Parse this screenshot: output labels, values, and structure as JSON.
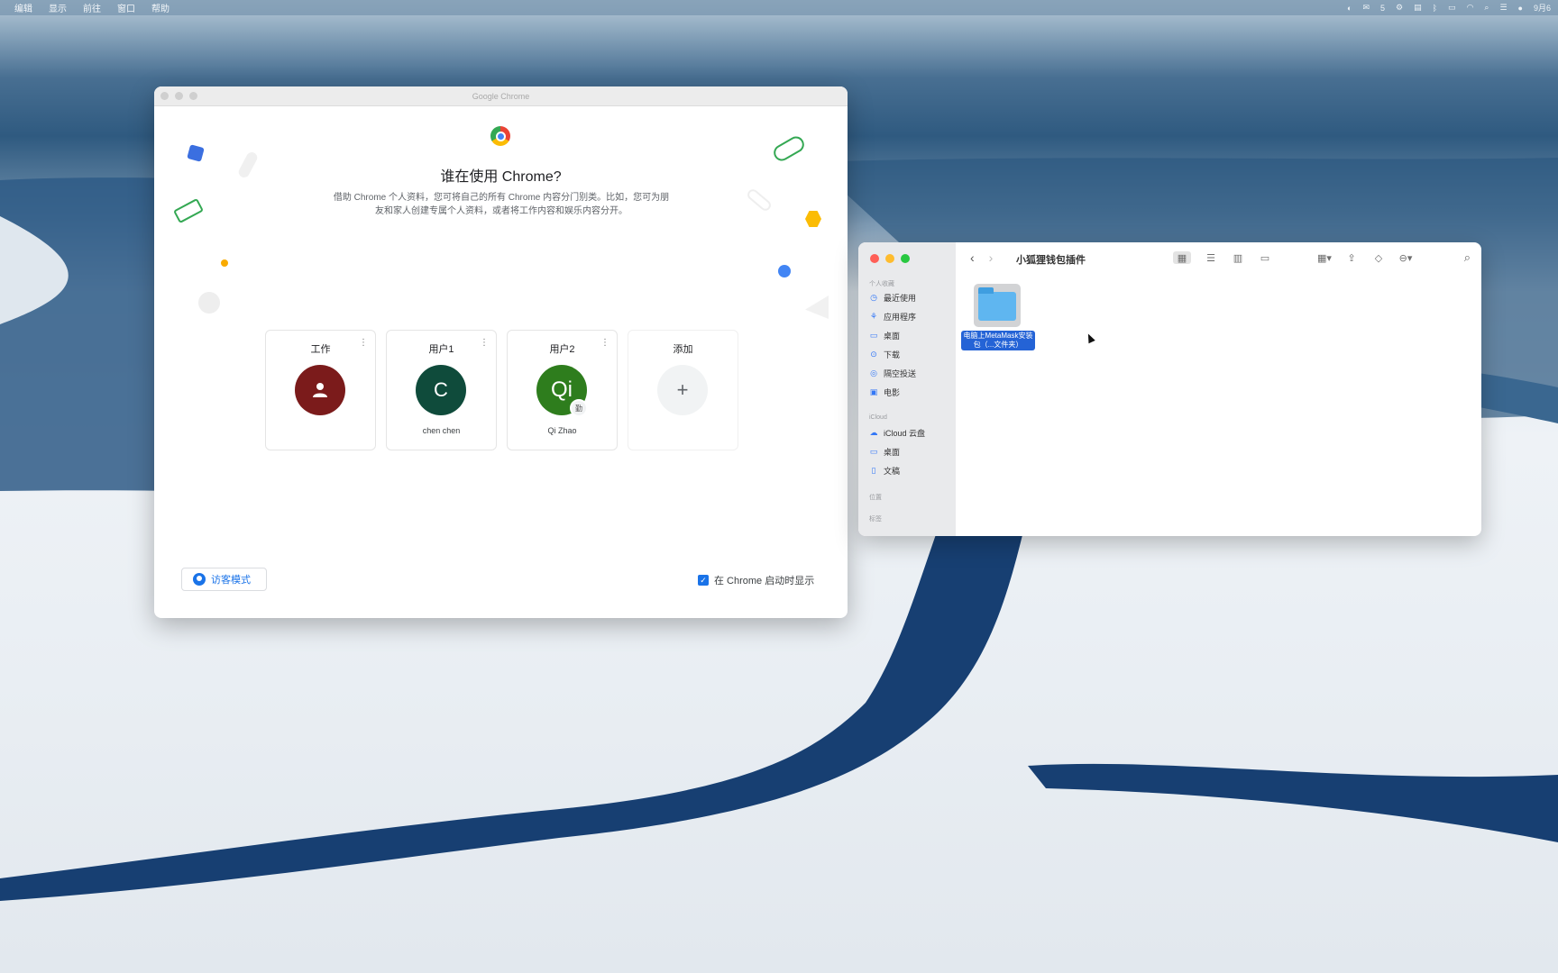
{
  "menubar": {
    "items": [
      "编辑",
      "显示",
      "前往",
      "窗口",
      "帮助"
    ],
    "status_wechat_count": "5",
    "status_date": "9月6"
  },
  "chrome": {
    "window_title": "Google Chrome",
    "heading": "谁在使用 Chrome?",
    "description": "借助 Chrome 个人资料，您可将自己的所有 Chrome 内容分门别类。比如，您可为朋友和家人创建专属个人资料，或者将工作内容和娱乐内容分开。",
    "profiles": [
      {
        "card_title": "工作",
        "user_name": "",
        "avatar_letter": "",
        "avatar_color": "#7b1b1b",
        "avatar_icon": "person-icon"
      },
      {
        "card_title": "用户1",
        "user_name": "chen chen",
        "avatar_letter": "C",
        "avatar_color": "#0f4b3b"
      },
      {
        "card_title": "用户2",
        "user_name": "Qi Zhao",
        "avatar_letter": "Qi",
        "avatar_color": "#2e7d1d",
        "badge": "勤"
      }
    ],
    "add_card": {
      "label": "添加",
      "icon": "plus-icon"
    },
    "guest_button": "访客模式",
    "show_on_startup_label": "在 Chrome 启动时显示",
    "show_on_startup_checked": true
  },
  "finder": {
    "title": "小狐狸钱包插件",
    "sidebar": {
      "favorites_label": "个人收藏",
      "favorites": [
        {
          "label": "最近使用",
          "icon": "clock-icon"
        },
        {
          "label": "应用程序",
          "icon": "apps-icon"
        },
        {
          "label": "桌面",
          "icon": "desktop-icon"
        },
        {
          "label": "下载",
          "icon": "download-icon"
        },
        {
          "label": "隔空投送",
          "icon": "airdrop-icon"
        },
        {
          "label": "电影",
          "icon": "movie-icon"
        }
      ],
      "icloud_label": "iCloud",
      "icloud": [
        {
          "label": "iCloud 云盘",
          "icon": "cloud-icon"
        },
        {
          "label": "桌面",
          "icon": "desktop-icon"
        },
        {
          "label": "文稿",
          "icon": "document-icon"
        }
      ],
      "locations_label": "位置",
      "tags_label": "标签"
    },
    "folder_name": "电脑上MetaMask安装包（...文件夹）"
  }
}
